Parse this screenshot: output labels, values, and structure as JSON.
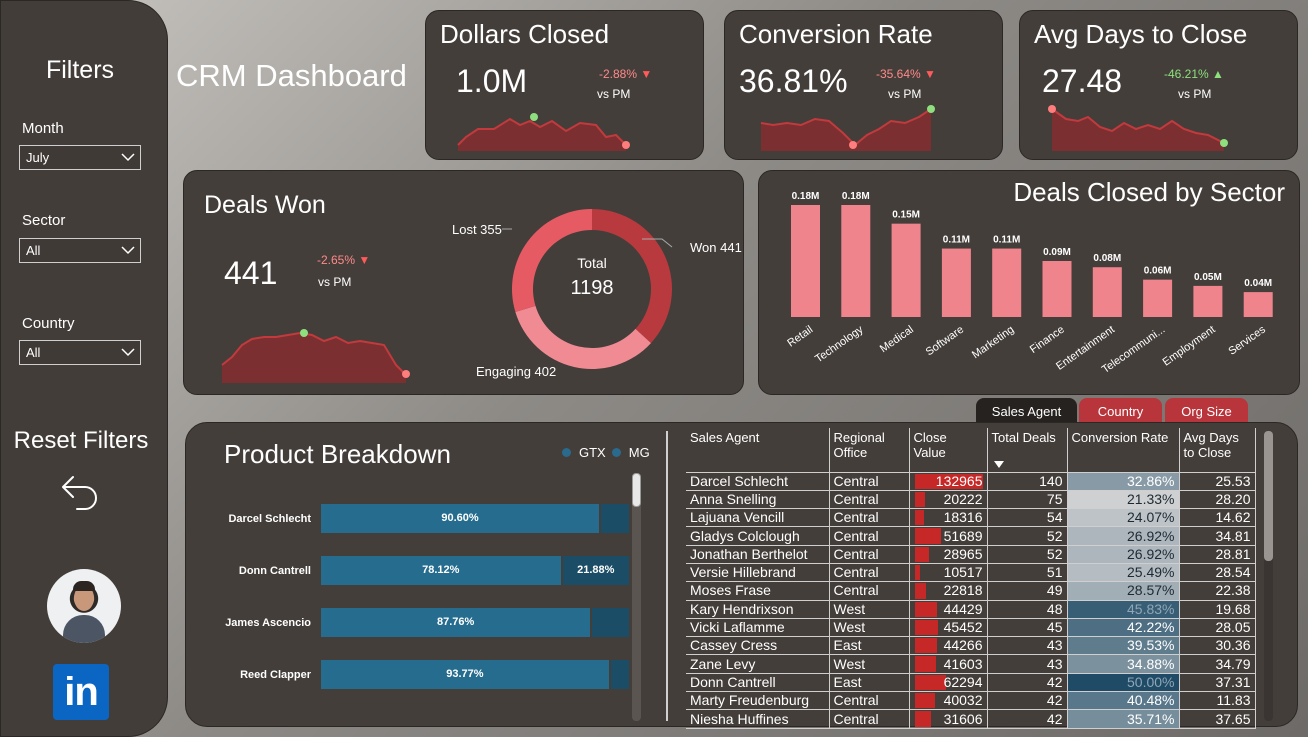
{
  "sidebar": {
    "title": "Filters",
    "filters": [
      {
        "label": "Month",
        "value": "July"
      },
      {
        "label": "Sector",
        "value": "All"
      },
      {
        "label": "Country",
        "value": "All"
      }
    ],
    "reset_label": "Reset Filters",
    "linkedin_label": "in",
    "icons": {
      "reset": "undo-arrow-icon",
      "linkedin": "linkedin-icon",
      "dropdown": "chevron-down-icon"
    }
  },
  "dashboard_title": "CRM Dashboard",
  "kpis": [
    {
      "title": "Dollars Closed",
      "value": "1.0M",
      "delta": "-2.88%",
      "direction": "down",
      "vs": "vs PM"
    },
    {
      "title": "Conversion Rate",
      "value": "36.81%",
      "delta": "-35.64%",
      "direction": "down",
      "vs": "vs PM"
    },
    {
      "title": "Avg Days to Close",
      "value": "27.48",
      "delta": "-46.21%",
      "direction": "up",
      "vs": "vs PM"
    }
  ],
  "deals_won": {
    "title": "Deals Won",
    "value": "441",
    "delta": "-2.65%",
    "direction": "down",
    "vs": "vs PM",
    "donut": {
      "center_label": "Total",
      "center_value": "1198",
      "segments": [
        {
          "label": "Won 441",
          "value": 441,
          "color": "#b83a3f"
        },
        {
          "label": "Engaging 402",
          "value": 402,
          "color": "#f08b94"
        },
        {
          "label": "Lost 355",
          "value": 355,
          "color": "#e65a64"
        }
      ]
    }
  },
  "chart_data": {
    "type": "bar",
    "title": "Deals Closed by Sector",
    "categories": [
      "Retail",
      "Technology",
      "Medical",
      "Software",
      "Marketing",
      "Finance",
      "Entertainment",
      "Telecommuni...",
      "Employment",
      "Services"
    ],
    "values": [
      0.18,
      0.18,
      0.15,
      0.11,
      0.11,
      0.09,
      0.08,
      0.06,
      0.05,
      0.04
    ],
    "data_labels": [
      "0.18M",
      "0.18M",
      "0.15M",
      "0.11M",
      "0.11M",
      "0.09M",
      "0.08M",
      "0.06M",
      "0.05M",
      "0.04M"
    ],
    "bar_color": "#f0848d"
  },
  "product_breakdown": {
    "title": "Product Breakdown",
    "legend": [
      "GTX",
      "MG"
    ],
    "rows": [
      {
        "name": "Darcel Schlecht",
        "gtx": 90.6,
        "gtx_label": "90.60%",
        "mg_label": ""
      },
      {
        "name": "Donn Cantrell",
        "gtx": 78.12,
        "gtx_label": "78.12%",
        "mg_label": "21.88%"
      },
      {
        "name": "James Ascencio",
        "gtx": 87.76,
        "gtx_label": "87.76%",
        "mg_label": ""
      },
      {
        "name": "Reed Clapper",
        "gtx": 93.77,
        "gtx_label": "93.77%",
        "mg_label": ""
      }
    ]
  },
  "tabs": [
    {
      "label": "Sales Agent",
      "active": true
    },
    {
      "label": "Country",
      "active": false
    },
    {
      "label": "Org Size",
      "active": false
    }
  ],
  "table": {
    "headers": [
      "Sales Agent",
      "Regional Office",
      "Close Value",
      "Total Deals",
      "Conversion Rate",
      "Avg Days to Close"
    ],
    "rows": [
      [
        "Darcel Schlecht",
        "Central",
        "132965",
        "140",
        "32.86%",
        "25.53"
      ],
      [
        "Anna Snelling",
        "Central",
        "20222",
        "75",
        "21.33%",
        "28.20"
      ],
      [
        "Lajuana Vencill",
        "Central",
        "18316",
        "54",
        "24.07%",
        "14.62"
      ],
      [
        "Gladys Colclough",
        "Central",
        "51689",
        "52",
        "26.92%",
        "34.81"
      ],
      [
        "Jonathan Berthelot",
        "Central",
        "28965",
        "52",
        "26.92%",
        "28.81"
      ],
      [
        "Versie Hillebrand",
        "Central",
        "10517",
        "51",
        "25.49%",
        "28.54"
      ],
      [
        "Moses Frase",
        "Central",
        "22818",
        "49",
        "28.57%",
        "22.38"
      ],
      [
        "Kary Hendrixson",
        "West",
        "44429",
        "48",
        "45.83%",
        "19.68"
      ],
      [
        "Vicki Laflamme",
        "West",
        "45452",
        "45",
        "42.22%",
        "28.05"
      ],
      [
        "Cassey Cress",
        "East",
        "44266",
        "43",
        "39.53%",
        "30.36"
      ],
      [
        "Zane Levy",
        "West",
        "41603",
        "43",
        "34.88%",
        "34.79"
      ],
      [
        "Donn Cantrell",
        "East",
        "62294",
        "42",
        "50.00%",
        "37.31"
      ],
      [
        "Marty Freudenburg",
        "Central",
        "40032",
        "42",
        "40.48%",
        "11.83"
      ],
      [
        "Niesha Huffines",
        "Central",
        "31606",
        "42",
        "35.71%",
        "37.65"
      ]
    ]
  }
}
